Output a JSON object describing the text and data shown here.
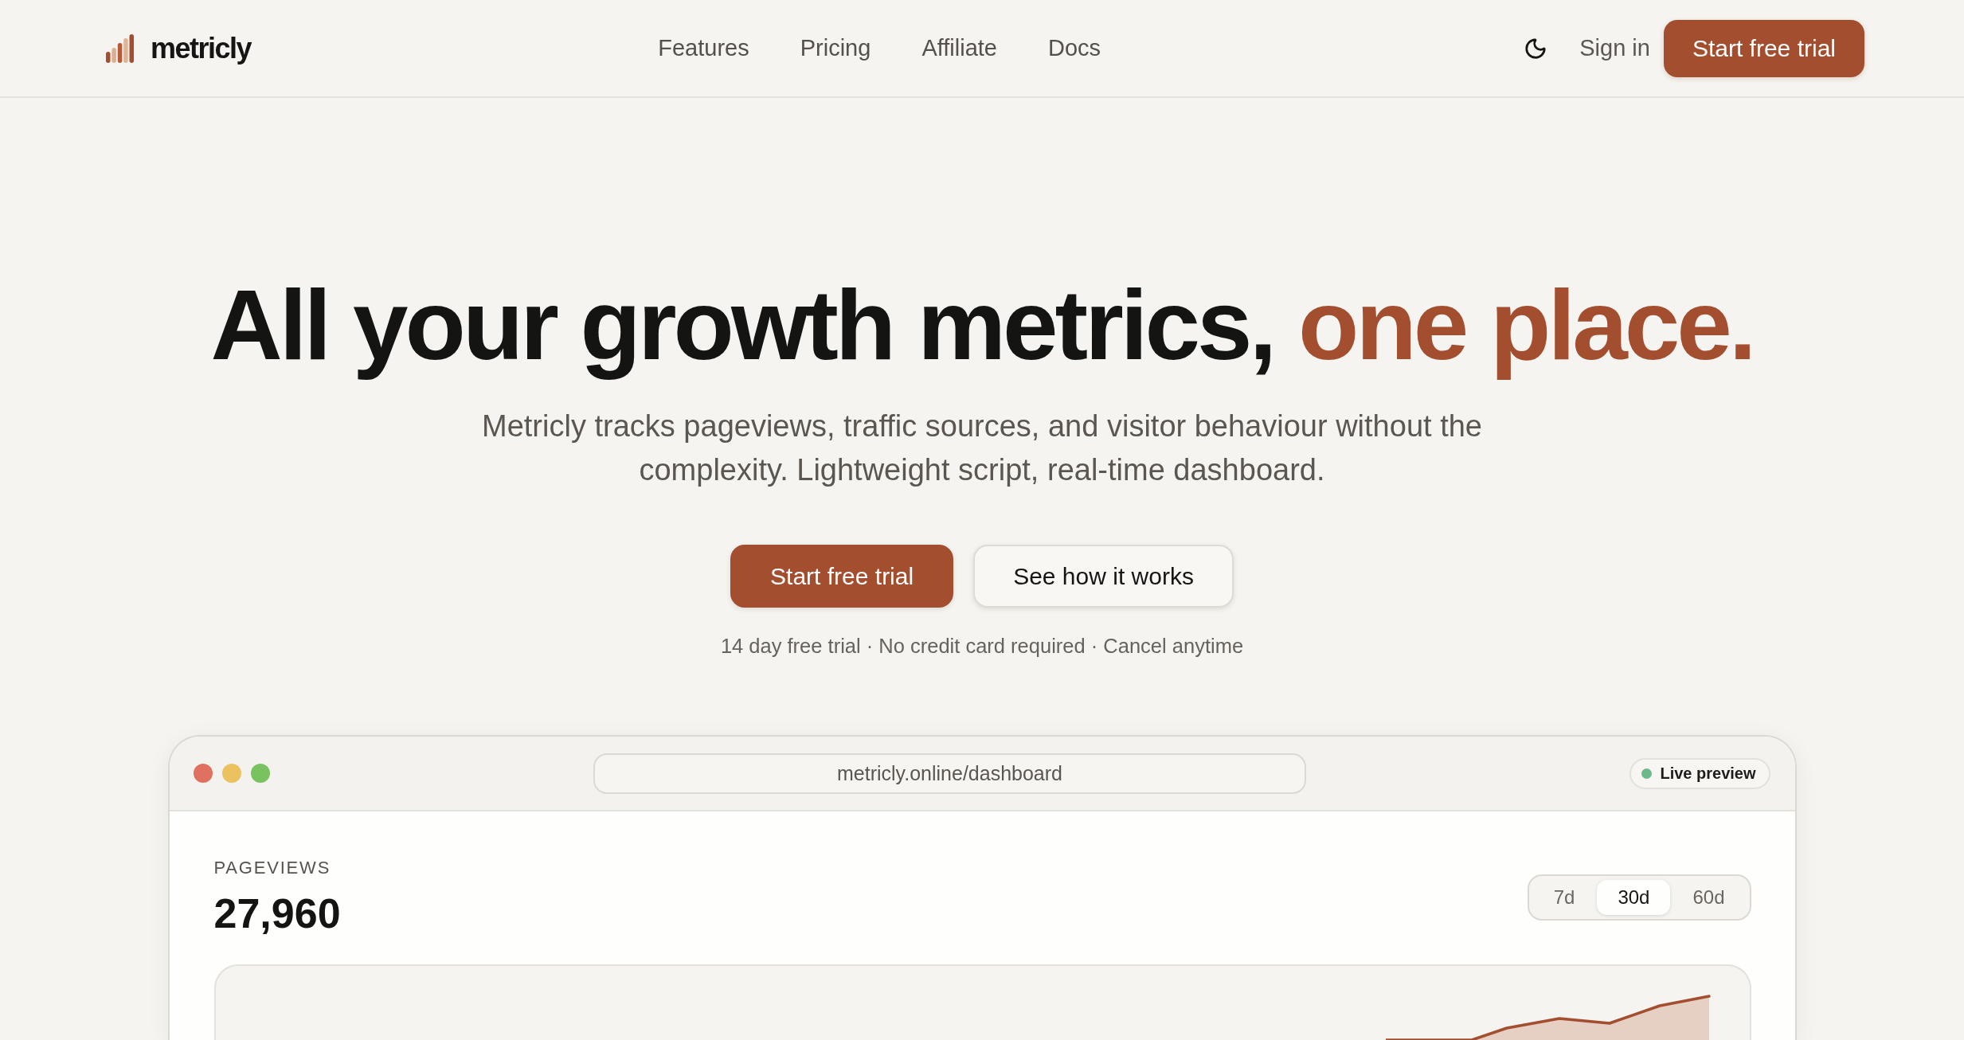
{
  "header": {
    "brand": "metricly",
    "nav": [
      "Features",
      "Pricing",
      "Affiliate",
      "Docs"
    ],
    "sign_in": "Sign in",
    "cta": "Start free trial"
  },
  "hero": {
    "headline": "All your growth metrics,",
    "headline_accent": "one place.",
    "subtitle": "Metricly tracks pageviews, traffic sources, and visitor behaviour without the complexity. Lightweight script, real-time dashboard.",
    "buttons": [
      {
        "label": "Start free trial",
        "kind": "primary"
      },
      {
        "label": "See how it works",
        "kind": "secondary"
      }
    ],
    "note": "14 day free trial · No credit card required · Cancel anytime"
  },
  "preview": {
    "url": "metricly.online/dashboard",
    "badge": "Live preview",
    "metric": {
      "label": "PAGEVIEWS",
      "value": "27,960"
    },
    "ranges": [
      {
        "label": "7d",
        "selected": false
      },
      {
        "label": "30d",
        "selected": true
      },
      {
        "label": "60d",
        "selected": false
      }
    ]
  }
}
